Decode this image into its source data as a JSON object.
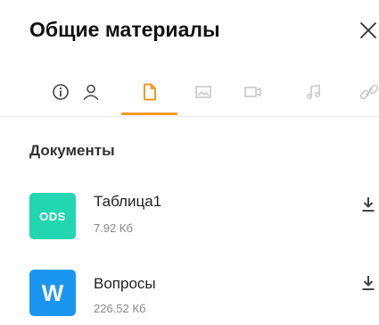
{
  "header": {
    "title": "Общие материалы",
    "close_icon": "close-icon"
  },
  "tabs": [
    {
      "name": "info",
      "icon": "info-icon",
      "active": false
    },
    {
      "name": "participants",
      "icon": "person-icon",
      "active": false
    },
    {
      "name": "documents",
      "icon": "document-icon",
      "active": true
    },
    {
      "name": "images",
      "icon": "image-icon",
      "active": false
    },
    {
      "name": "video",
      "icon": "video-icon",
      "active": false
    },
    {
      "name": "audio",
      "icon": "music-note-icon",
      "active": false
    },
    {
      "name": "links",
      "icon": "link-icon",
      "active": false
    }
  ],
  "colors": {
    "accent": "#f39a20",
    "ods_icon": "#21d6b0",
    "word_icon": "#1a96f0",
    "inactive_icon": "#c8c8c8",
    "dark_icon": "#444444"
  },
  "documents": {
    "section_title": "Документы",
    "files": [
      {
        "name": "Таблица1",
        "size": "7.92 Кб",
        "icon_label": "ODS",
        "icon_color": "#21d6b0"
      },
      {
        "name": "Вопросы",
        "size": "226.52 Кб",
        "icon_label": "W",
        "icon_color": "#1a96f0"
      }
    ]
  }
}
